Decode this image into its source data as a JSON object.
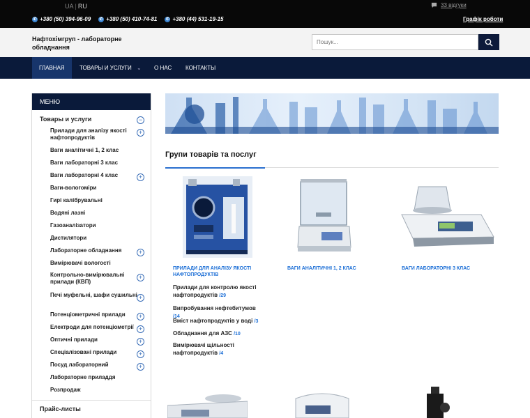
{
  "topbar": {
    "lang_ua": "UA",
    "lang_sep": "|",
    "lang_ru": "RU",
    "reviews": "33 відгуки",
    "phones": [
      "+380 (50) 394-96-09",
      "+380 (50) 410-74-81",
      "+380 (44) 531-19-15"
    ],
    "schedule": "Графік роботи"
  },
  "header": {
    "site_name": "Нафтохімгруп - лабораторне обладнання",
    "search_placeholder": "Пошук..."
  },
  "nav": {
    "items": [
      "Главная",
      "Товары и услуги",
      "О нас",
      "Контакты"
    ]
  },
  "sidebar": {
    "title": "Меню",
    "category": "Товары и услуги",
    "items": [
      "Прилади для аналізу якості нафтопродуктів",
      "Ваги аналітичні 1, 2 клас",
      "Ваги лабораторні 3 клас",
      "Ваги лабораторні 4 клас",
      "Ваги-вологоміри",
      "Гирі калібрувальні",
      "Водяні лазні",
      "Газоаналізатори",
      "Дистилятори",
      "Лабораторне обладнання",
      "Вимірювачі вологості",
      "Контрольно-вимірювальні прилади (КВП)",
      "Печі муфельні, шафи сушильні",
      "Потенціометричні прилади",
      "Електроди для потенціометрії",
      "Оптичні прилади",
      "Спеціалізовані прилади",
      "Посуд лабораторний",
      "Лабораторне приладдя",
      "Розпродаж"
    ],
    "price": "Прайс-листы"
  },
  "content": {
    "groups_title": "Групи товарів та послуг",
    "products": [
      "Прилади для аналізу якості нафтопродуктів",
      "Ваги аналітичні 1, 2 клас",
      "Ваги лабораторні 3 клас"
    ],
    "subcategories": [
      {
        "label": "Прилади для контролю якості нафтопродуктів",
        "count": "/29"
      },
      {
        "label": "Випробування нефтебитумов",
        "count": "/14"
      },
      {
        "label": "Вміст нафтопродуктів у воді",
        "count": "/3"
      },
      {
        "label": "Обладнання для АЗС",
        "count": "/10"
      },
      {
        "label": "Вимірювачі щільності нафтопродуктів",
        "count": "/4"
      }
    ]
  },
  "colors": {
    "nav_bg": "#0a1a3a",
    "nav_active": "#17356b",
    "accent_blue": "#1b6ed6",
    "topbar_bg": "#080808"
  }
}
